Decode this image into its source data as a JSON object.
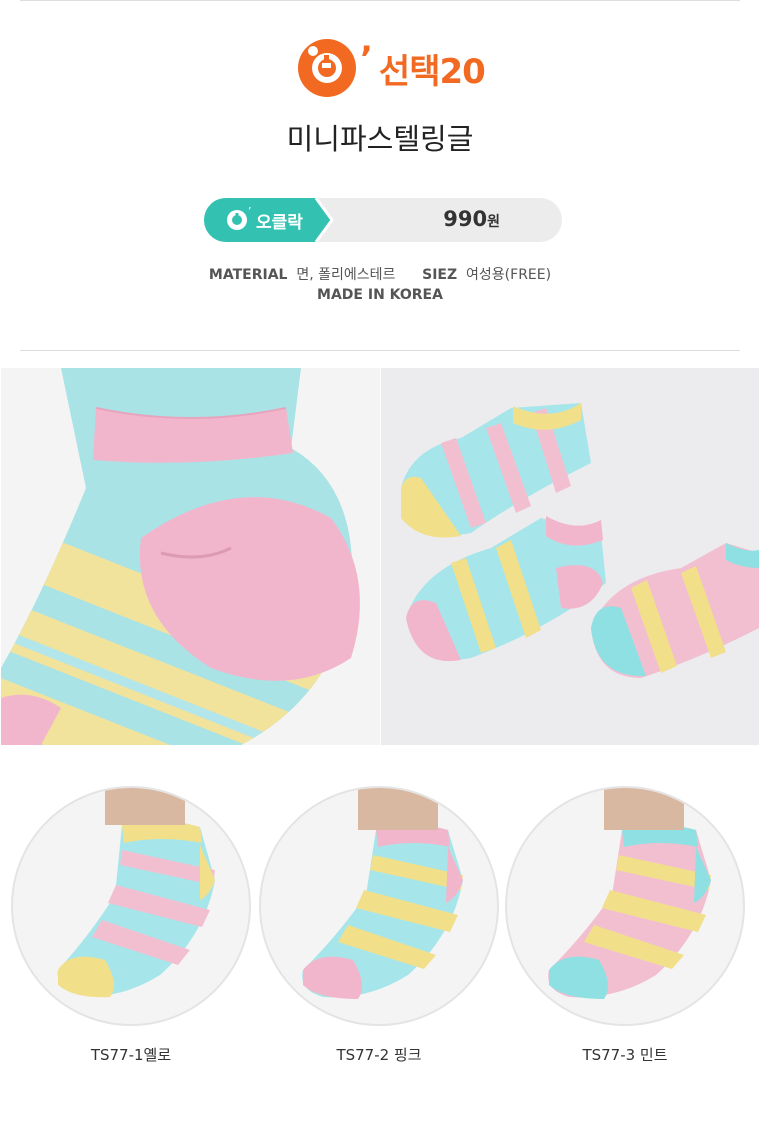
{
  "brand": {
    "logo_text": "선택20",
    "colors": {
      "orange": "#f26a21",
      "mint": "#33c2b1"
    }
  },
  "product": {
    "title": "미니파스텔링글"
  },
  "price": {
    "badge_label": "오클락",
    "value": "990",
    "unit": "원"
  },
  "specs": {
    "material_label": "MATERIAL",
    "material_value": "면, 폴리에스테르",
    "size_label": "SIEZ",
    "size_value": "여성용(FREE)",
    "origin": "MADE IN KOREA"
  },
  "photos": [
    {
      "icon": "sock-heel-closeup"
    },
    {
      "icon": "three-socks-flatlay"
    }
  ],
  "variants": [
    {
      "label": "TS77-1옐로",
      "main": "#f2df8e"
    },
    {
      "label": "TS77-2 핑크",
      "main": "#f2b5cc"
    },
    {
      "label": "TS77-3 민트",
      "main": "#8fe3e3"
    }
  ]
}
